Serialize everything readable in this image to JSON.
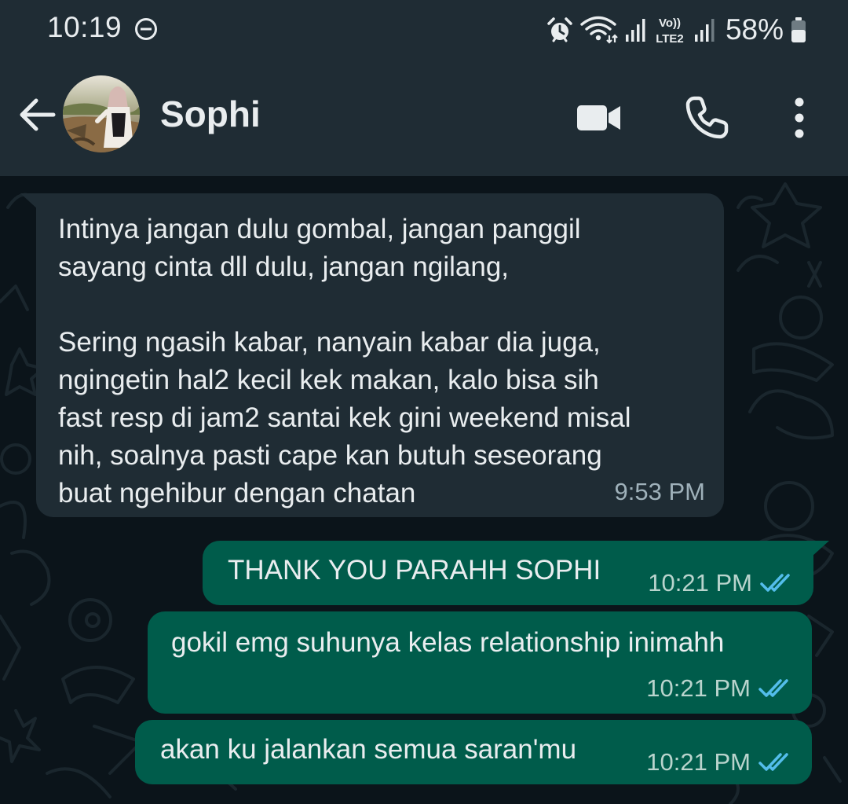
{
  "status_bar": {
    "time": "10:19",
    "battery_text": "58%",
    "icons": [
      "do-not-disturb-icon",
      "alarm-icon",
      "wifi-icon",
      "signal-icon",
      "volte-lte2-icon",
      "signal-2-icon",
      "battery-icon"
    ],
    "volte_top": "Vo))",
    "volte_bottom": "LTE2"
  },
  "header": {
    "contact_name": "Sophi",
    "actions": [
      "video-call-icon",
      "voice-call-icon",
      "more-options-icon"
    ]
  },
  "colors": {
    "header_bg": "#1f2c34",
    "chat_bg": "#0b141a",
    "incoming_bubble": "#1f2c34",
    "outgoing_bubble": "#005c4b",
    "read_tick": "#53bdeb"
  },
  "messages": [
    {
      "direction": "incoming",
      "text": "Intinya jangan dulu gombal, jangan panggil\nsayang cinta dll dulu, jangan ngilang,\n\nSering ngasih kabar, nanyain kabar dia juga,\nngingetin hal2 kecil kek makan, kalo bisa sih\nfast resp di jam2 santai kek gini weekend misal\nnih, soalnya pasti cape kan butuh seseorang\nbuat ngehibur dengan chatan",
      "time": "9:53 PM"
    },
    {
      "direction": "outgoing",
      "text": "THANK YOU PARAHH SOPHI",
      "time": "10:21 PM",
      "status": "read"
    },
    {
      "direction": "outgoing",
      "text": "gokil emg suhunya kelas relationship inimahh",
      "time": "10:21 PM",
      "status": "read"
    },
    {
      "direction": "outgoing",
      "text": "akan ku jalankan semua saran'mu",
      "time": "10:21 PM",
      "status": "read"
    }
  ]
}
